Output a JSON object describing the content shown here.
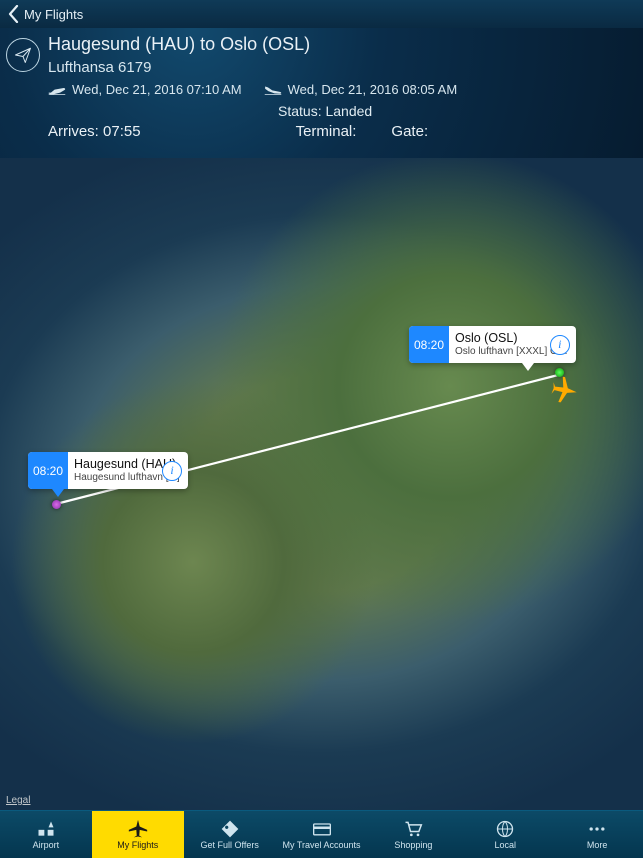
{
  "nav": {
    "back_label": "My Flights"
  },
  "flight": {
    "route_title": "Haugesund (HAU) to Oslo (OSL)",
    "airline_number": "Lufthansa 6179",
    "departure_time": "Wed, Dec 21, 2016 07:10 AM",
    "arrival_time": "Wed, Dec 21, 2016 08:05 AM",
    "status_label": "Status:",
    "status_value": "Landed",
    "arrives_label": "Arrives:",
    "arrives_value": "07:55",
    "terminal_label": "Terminal:",
    "terminal_value": "",
    "gate_label": "Gate:",
    "gate_value": ""
  },
  "map": {
    "origin": {
      "time": "08:20",
      "title": "Haugesund (HAU)",
      "subtitle": "Haugesund lufthavn [M]"
    },
    "destination": {
      "time": "08:20",
      "title": "Oslo (OSL)",
      "subtitle": "Oslo lufthavn [XXXL] G…"
    },
    "legal": "Legal"
  },
  "tabs": {
    "airport": "Airport",
    "my_flights": "My Flights",
    "offers": "Get Full Offers",
    "accounts": "My Travel Accounts",
    "shopping": "Shopping",
    "local": "Local",
    "more": "More"
  }
}
